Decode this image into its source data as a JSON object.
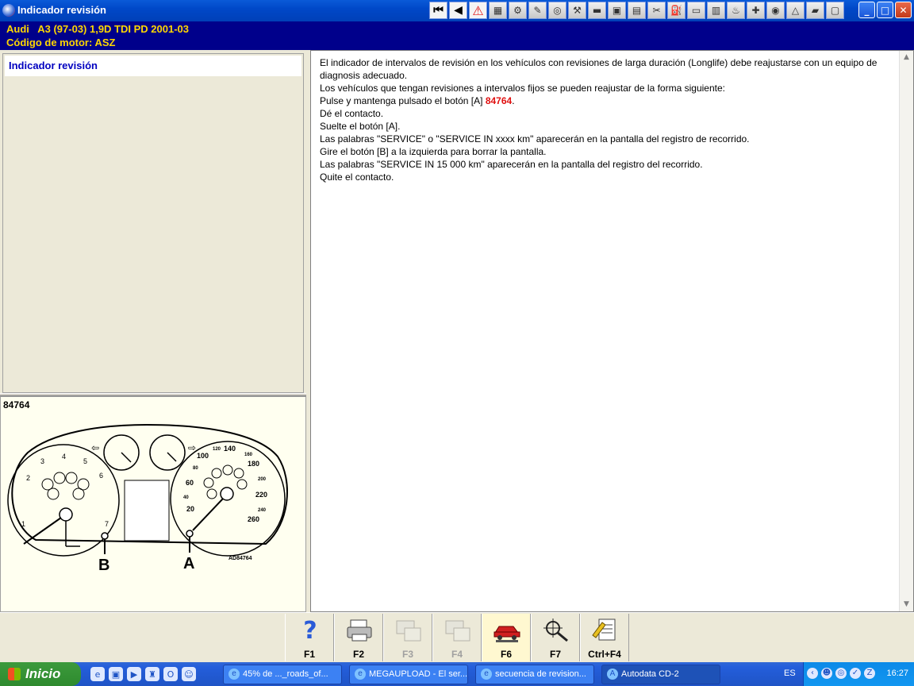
{
  "window": {
    "title": "Indicador revisión"
  },
  "toolbar": {
    "buttons": [
      "first-icon",
      "previous-icon",
      "warning-icon",
      "tool-icon",
      "tool-icon",
      "tool-icon",
      "tool-icon",
      "tool-icon",
      "tool-icon",
      "tool-icon",
      "tool-icon",
      "tool-icon",
      "tool-icon",
      "tool-icon",
      "tool-icon",
      "tool-icon",
      "tool-icon",
      "tool-icon",
      "tool-icon",
      "tool-icon",
      "tool-icon",
      "tool-icon"
    ],
    "window_buttons": {
      "minimize": "_",
      "maximize": "□",
      "close": "✕"
    }
  },
  "header": {
    "vehicle": "Audi   A3 (97-03) 1,9D TDI PD 2001-03",
    "engine": "Código de motor: ASZ"
  },
  "nav": {
    "items": [
      {
        "label": "Indicador revisión"
      }
    ]
  },
  "image_panel": {
    "reference": "84764",
    "callouts": {
      "b": "B",
      "a": "A",
      "code": "AD84764"
    },
    "speed_labels": [
      "100",
      "120",
      "140",
      "160",
      "180",
      "200",
      "220",
      "240",
      "260",
      "20",
      "40",
      "60",
      "80"
    ],
    "rpm_labels": [
      "1",
      "2",
      "3",
      "4",
      "5",
      "6",
      "7"
    ]
  },
  "content": {
    "line1": "El indicador de intervalos de revisión en los vehículos con revisiones de larga duración (Longlife) debe reajustarse con un equipo de diagnosis adecuado.",
    "line2": "Los vehículos que tengan revisiones a intervalos fijos se pueden reajustar de la forma siguiente:",
    "line3_prefix": "Pulse y mantenga pulsado el botón [A] ",
    "line3_ref": "84764",
    "line3_suffix": ".",
    "line4": "Dé el contacto.",
    "line5": "Suelte el botón [A].",
    "line6": "Las palabras \"SERVICE\" o \"SERVICE IN xxxx km\" aparecerán en la pantalla del registro de recorrido.",
    "line7": "Gire el botón [B] a la izquierda para borrar la pantalla.",
    "line8": "Las palabras \"SERVICE IN 15 000 km\" aparecerán en la pantalla del registro del recorrido.",
    "line9": "Quite el contacto."
  },
  "function_keys": [
    {
      "label": "F1",
      "icon": "help-icon",
      "enabled": true
    },
    {
      "label": "F2",
      "icon": "print-icon",
      "enabled": true
    },
    {
      "label": "F3",
      "icon": "diagram-icon",
      "enabled": false
    },
    {
      "label": "F4",
      "icon": "diagram-icon",
      "enabled": false
    },
    {
      "label": "F6",
      "icon": "car-service-icon",
      "enabled": true
    },
    {
      "label": "F7",
      "icon": "magnifier-icon",
      "enabled": true
    },
    {
      "label": "Ctrl+F4",
      "icon": "notes-icon",
      "enabled": true
    }
  ],
  "taskbar": {
    "start_label": "Inicio",
    "tasks": [
      {
        "label": "45% de ..._roads_of..."
      },
      {
        "label": "MEGAUPLOAD - El ser..."
      },
      {
        "label": "secuencia de revision..."
      },
      {
        "label": "Autodata CD-2"
      }
    ],
    "language": "ES",
    "clock": "16:27"
  }
}
